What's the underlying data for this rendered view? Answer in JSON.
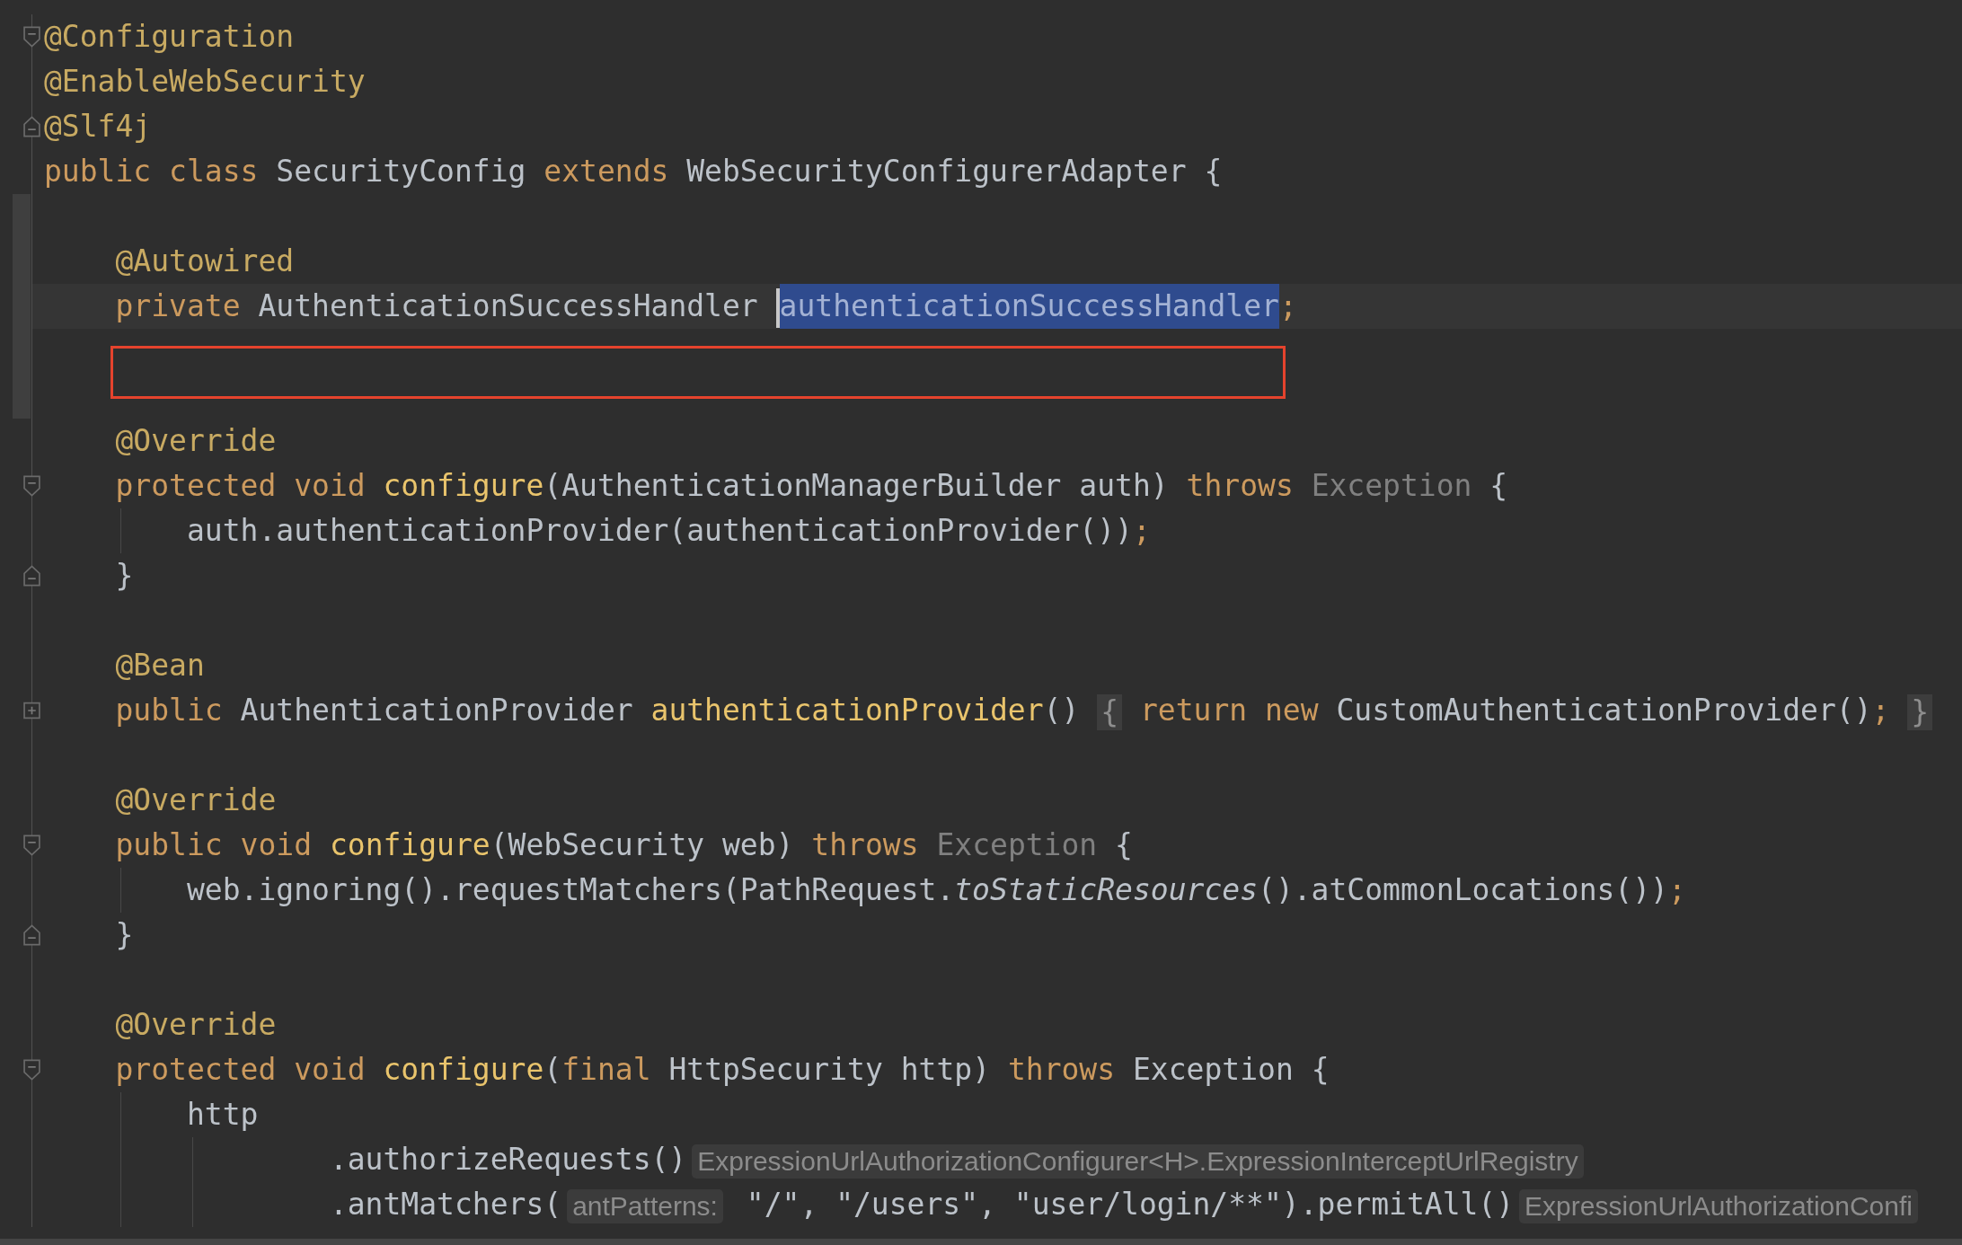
{
  "editor": {
    "lines": [
      {
        "kind": "code",
        "fold": {
          "kind": "start"
        },
        "current": false,
        "changed": false,
        "outlined": false,
        "tokens": [
          {
            "text": "@Configuration",
            "kind": "annotation"
          }
        ]
      },
      {
        "kind": "code",
        "current": false,
        "changed": false,
        "outlined": false,
        "tokens": [
          {
            "text": "@EnableWebSecurity",
            "kind": "annotation"
          }
        ]
      },
      {
        "kind": "code",
        "fold": {
          "kind": "end"
        },
        "current": false,
        "changed": false,
        "outlined": false,
        "tokens": [
          {
            "text": "@Slf4j",
            "kind": "annotation"
          }
        ]
      },
      {
        "kind": "code",
        "current": false,
        "changed": false,
        "outlined": false,
        "tokens": [
          {
            "text": "public class ",
            "kind": "keyword"
          },
          {
            "text": "SecurityConfig ",
            "kind": "plain"
          },
          {
            "text": "extends ",
            "kind": "keyword"
          },
          {
            "text": "WebSecurityConfigurerAdapter {",
            "kind": "plain"
          }
        ],
        "children": [
          {
            "kind": "blank",
            "current": false,
            "changed": true,
            "outlined": false
          },
          {
            "kind": "code",
            "current": false,
            "changed": true,
            "outlined": false,
            "tokens": [
              {
                "text": "@Autowired",
                "kind": "annotation"
              }
            ]
          },
          {
            "kind": "code",
            "current": true,
            "changed": true,
            "outlined": false,
            "tokens": [
              {
                "text": "private ",
                "kind": "keyword"
              },
              {
                "text": "AuthenticationSuccessHandler ",
                "kind": "plain"
              },
              {
                "text": "authenticationSuccessHandler",
                "kind": "selection"
              },
              {
                "text": ";",
                "kind": "punctuation"
              }
            ]
          },
          {
            "kind": "blank",
            "current": false,
            "changed": true,
            "outlined": true
          },
          {
            "kind": "blank",
            "current": false,
            "changed": true,
            "outlined": false
          },
          {
            "kind": "code",
            "current": false,
            "changed": false,
            "outlined": false,
            "tokens": [
              {
                "text": "@Override",
                "kind": "annotation"
              }
            ]
          },
          {
            "kind": "code",
            "fold": {
              "kind": "start"
            },
            "current": false,
            "changed": false,
            "outlined": false,
            "tokens": [
              {
                "text": "protected void ",
                "kind": "keyword"
              },
              {
                "text": "configure",
                "kind": "method"
              },
              {
                "text": "(AuthenticationManagerBuilder auth) ",
                "kind": "plain"
              },
              {
                "text": "throws ",
                "kind": "keyword"
              },
              {
                "text": "Exception",
                "kind": "dim"
              },
              {
                "text": " {",
                "kind": "plain"
              }
            ],
            "children": [
              {
                "kind": "code",
                "current": false,
                "changed": false,
                "outlined": false,
                "tokens": [
                  {
                    "text": "auth.authenticationProvider(authenticationProvider())",
                    "kind": "plain"
                  },
                  {
                    "text": ";",
                    "kind": "punctuation"
                  }
                ]
              }
            ]
          },
          {
            "kind": "code",
            "fold": {
              "kind": "end"
            },
            "current": false,
            "changed": false,
            "outlined": false,
            "tokens": [
              {
                "text": "}",
                "kind": "plain"
              }
            ]
          },
          {
            "kind": "blank",
            "current": false,
            "changed": false,
            "outlined": false
          },
          {
            "kind": "code",
            "current": false,
            "changed": false,
            "outlined": false,
            "tokens": [
              {
                "text": "@Bean",
                "kind": "annotation"
              }
            ]
          },
          {
            "kind": "code",
            "fold": {
              "kind": "collapsed"
            },
            "current": false,
            "changed": false,
            "outlined": false,
            "tokens": [
              {
                "text": "public ",
                "kind": "keyword"
              },
              {
                "text": "AuthenticationProvider ",
                "kind": "plain"
              },
              {
                "text": "authenticationProvider",
                "kind": "method"
              },
              {
                "text": "() ",
                "kind": "plain"
              },
              {
                "text": "{",
                "kind": "fold"
              },
              {
                "text": " return new ",
                "kind": "keyword"
              },
              {
                "text": "CustomAuthenticationProvider()",
                "kind": "plain"
              },
              {
                "text": "; ",
                "kind": "punctuation"
              },
              {
                "text": "}",
                "kind": "fold"
              }
            ]
          },
          {
            "kind": "blank",
            "current": false,
            "changed": false,
            "outlined": false
          },
          {
            "kind": "code",
            "current": false,
            "changed": false,
            "outlined": false,
            "tokens": [
              {
                "text": "@Override",
                "kind": "annotation"
              }
            ]
          },
          {
            "kind": "code",
            "fold": {
              "kind": "start"
            },
            "current": false,
            "changed": false,
            "outlined": false,
            "tokens": [
              {
                "text": "public void ",
                "kind": "keyword"
              },
              {
                "text": "configure",
                "kind": "method"
              },
              {
                "text": "(WebSecurity web) ",
                "kind": "plain"
              },
              {
                "text": "throws ",
                "kind": "keyword"
              },
              {
                "text": "Exception",
                "kind": "dim"
              },
              {
                "text": " {",
                "kind": "plain"
              }
            ],
            "children": [
              {
                "kind": "code",
                "current": false,
                "changed": false,
                "outlined": false,
                "tokens": [
                  {
                    "text": "web.ignoring().requestMatchers(PathRequest.",
                    "kind": "plain"
                  },
                  {
                    "text": "toStaticResources",
                    "kind": "static"
                  },
                  {
                    "text": "().atCommonLocations())",
                    "kind": "plain"
                  },
                  {
                    "text": ";",
                    "kind": "punctuation"
                  }
                ]
              }
            ]
          },
          {
            "kind": "code",
            "fold": {
              "kind": "end"
            },
            "current": false,
            "changed": false,
            "outlined": false,
            "tokens": [
              {
                "text": "}",
                "kind": "plain"
              }
            ]
          },
          {
            "kind": "blank",
            "current": false,
            "changed": false,
            "outlined": false
          },
          {
            "kind": "code",
            "current": false,
            "changed": false,
            "outlined": false,
            "tokens": [
              {
                "text": "@Override",
                "kind": "annotation"
              }
            ]
          },
          {
            "kind": "code",
            "fold": {
              "kind": "start"
            },
            "current": false,
            "changed": false,
            "outlined": false,
            "tokens": [
              {
                "text": "protected void ",
                "kind": "keyword"
              },
              {
                "text": "configure",
                "kind": "method"
              },
              {
                "text": "(",
                "kind": "plain"
              },
              {
                "text": "final ",
                "kind": "keyword"
              },
              {
                "text": "HttpSecurity http) ",
                "kind": "plain"
              },
              {
                "text": "throws ",
                "kind": "keyword"
              },
              {
                "text": "Exception {",
                "kind": "plain"
              }
            ],
            "children": [
              {
                "kind": "code",
                "current": false,
                "changed": false,
                "outlined": false,
                "tokens": [
                  {
                    "text": "http",
                    "kind": "plain"
                  }
                ],
                "children": [
                  {
                    "kind": "continuation",
                    "current": false,
                    "changed": false,
                    "outlined": false,
                    "tokens": [
                      {
                        "text": ".authorizeRequests()",
                        "kind": "plain"
                      },
                      {
                        "text": "ExpressionUrlAuthorizationConfigurer<H>.ExpressionInterceptUrlRegistry",
                        "kind": "hint"
                      }
                    ]
                  },
                  {
                    "kind": "continuation",
                    "current": false,
                    "changed": false,
                    "outlined": false,
                    "tokens": [
                      {
                        "text": ".antMatchers(",
                        "kind": "plain"
                      },
                      {
                        "text": "antPatterns:",
                        "kind": "hint"
                      },
                      {
                        "text": " \"/\", \"/users\", \"user/login/**\").permitAll()",
                        "kind": "plain"
                      },
                      {
                        "text": "ExpressionUrlAuthorizationConfi",
                        "kind": "hint"
                      }
                    ]
                  }
                ]
              }
            ]
          }
        ]
      }
    ]
  }
}
